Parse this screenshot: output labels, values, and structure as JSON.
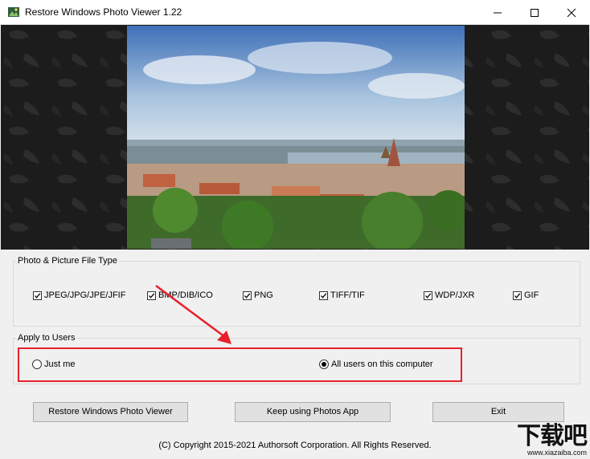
{
  "window": {
    "title": "Restore Windows Photo Viewer 1.22",
    "minimize": "—",
    "maximize": "☐",
    "close": "✕"
  },
  "file_types": {
    "group_label": "Photo & Picture File Type",
    "items": [
      {
        "label": "JPEG/JPG/JPE/JFIF",
        "checked": true
      },
      {
        "label": "BMP/DIB/ICO",
        "checked": true
      },
      {
        "label": "PNG",
        "checked": true
      },
      {
        "label": "TIFF/TIF",
        "checked": true
      },
      {
        "label": "WDP/JXR",
        "checked": true
      },
      {
        "label": "GIF",
        "checked": true
      }
    ]
  },
  "apply_users": {
    "group_label": "Apply to Users",
    "options": [
      {
        "label": "Just me",
        "selected": false
      },
      {
        "label": "All users on this computer",
        "selected": true
      }
    ]
  },
  "buttons": {
    "restore": "Restore Windows Photo Viewer",
    "keep": "Keep using Photos App",
    "exit": "Exit"
  },
  "copyright": "(C) Copyright 2015-2021 Authorsoft Corporation. All Rights Reserved.",
  "watermark": {
    "main": "下载吧",
    "url": "www.xiazaiba.com"
  },
  "colors": {
    "annotation_red": "#e8202a",
    "window_bg": "#f0f0f0",
    "banner_bg": "#1c1c1c"
  }
}
